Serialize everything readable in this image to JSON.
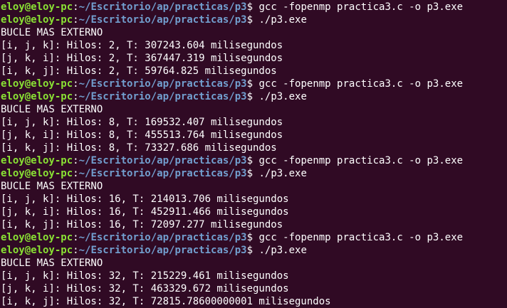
{
  "colors": {
    "background": "#300a24",
    "prompt_user": "#8ae234",
    "prompt_path": "#729fcf",
    "text": "#ffffff"
  },
  "lines": [
    {
      "kind": "prompt",
      "user": "eloy@eloy-pc",
      "sep": ":",
      "path": "~/Escritorio/ap/practicas/p3",
      "sym": "$ ",
      "cmd": "gcc -fopenmp practica3.c -o p3.exe"
    },
    {
      "kind": "prompt",
      "user": "eloy@eloy-pc",
      "sep": ":",
      "path": "~/Escritorio/ap/practicas/p3",
      "sym": "$ ",
      "cmd": "./p3.exe"
    },
    {
      "kind": "output",
      "text": "BUCLE MAS EXTERNO"
    },
    {
      "kind": "output",
      "text": "[i, j, k]: Hilos: 2, T: 307243.604 milisegundos"
    },
    {
      "kind": "output",
      "text": "[j, k, i]: Hilos: 2, T: 367447.319 milisegundos"
    },
    {
      "kind": "output",
      "text": "[i, k, j]: Hilos: 2, T: 59764.825 milisegundos"
    },
    {
      "kind": "prompt",
      "user": "eloy@eloy-pc",
      "sep": ":",
      "path": "~/Escritorio/ap/practicas/p3",
      "sym": "$ ",
      "cmd": "gcc -fopenmp practica3.c -o p3.exe"
    },
    {
      "kind": "prompt",
      "user": "eloy@eloy-pc",
      "sep": ":",
      "path": "~/Escritorio/ap/practicas/p3",
      "sym": "$ ",
      "cmd": "./p3.exe"
    },
    {
      "kind": "output",
      "text": "BUCLE MAS EXTERNO"
    },
    {
      "kind": "output",
      "text": "[i, j, k]: Hilos: 8, T: 169532.407 milisegundos"
    },
    {
      "kind": "output",
      "text": "[j, k, i]: Hilos: 8, T: 455513.764 milisegundos"
    },
    {
      "kind": "output",
      "text": "[i, k, j]: Hilos: 8, T: 73327.686 milisegundos"
    },
    {
      "kind": "prompt",
      "user": "eloy@eloy-pc",
      "sep": ":",
      "path": "~/Escritorio/ap/practicas/p3",
      "sym": "$ ",
      "cmd": "gcc -fopenmp practica3.c -o p3.exe"
    },
    {
      "kind": "prompt",
      "user": "eloy@eloy-pc",
      "sep": ":",
      "path": "~/Escritorio/ap/practicas/p3",
      "sym": "$ ",
      "cmd": "./p3.exe"
    },
    {
      "kind": "output",
      "text": "BUCLE MAS EXTERNO"
    },
    {
      "kind": "output",
      "text": "[i, j, k]: Hilos: 16, T: 214013.706 milisegundos"
    },
    {
      "kind": "output",
      "text": "[j, k, i]: Hilos: 16, T: 452911.466 milisegundos"
    },
    {
      "kind": "output",
      "text": "[i, k, j]: Hilos: 16, T: 72097.277 milisegundos"
    },
    {
      "kind": "prompt",
      "user": "eloy@eloy-pc",
      "sep": ":",
      "path": "~/Escritorio/ap/practicas/p3",
      "sym": "$ ",
      "cmd": "gcc -fopenmp practica3.c -o p3.exe"
    },
    {
      "kind": "prompt",
      "user": "eloy@eloy-pc",
      "sep": ":",
      "path": "~/Escritorio/ap/practicas/p3",
      "sym": "$ ",
      "cmd": "./p3.exe"
    },
    {
      "kind": "output",
      "text": "BUCLE MAS EXTERNO"
    },
    {
      "kind": "output",
      "text": "[i, j, k]: Hilos: 32, T: 215229.461 milisegundos"
    },
    {
      "kind": "output",
      "text": "[j, k, i]: Hilos: 32, T: 463329.672 milisegundos"
    },
    {
      "kind": "output",
      "text": "[i, k, j]: Hilos: 32, T: 72815.78600000001 milisegundos"
    }
  ]
}
